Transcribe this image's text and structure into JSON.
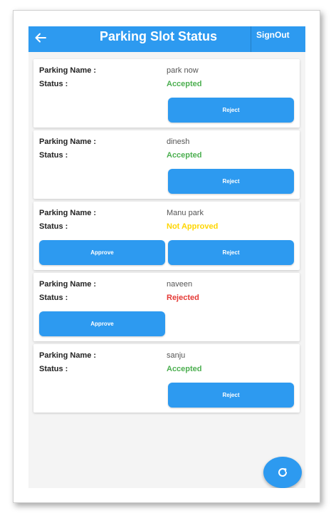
{
  "app_bar": {
    "title": "Parking Slot Status",
    "signout_label": "SignOut",
    "back_icon": "arrow-left-icon",
    "background": "#2d9af0"
  },
  "labels": {
    "parking_name": "Parking Name :",
    "status": "Status :"
  },
  "buttons": {
    "approve": "Approve",
    "reject": "Reject"
  },
  "status_colors": {
    "Accepted": "#4caf50",
    "Not Approved": "#ffd600",
    "Rejected": "#e53935"
  },
  "parkings": [
    {
      "name": "park now",
      "status": "Accepted",
      "actions": [
        "reject"
      ]
    },
    {
      "name": "dinesh",
      "status": "Accepted",
      "actions": [
        "reject"
      ]
    },
    {
      "name": "Manu park",
      "status": "Not Approved",
      "actions": [
        "approve",
        "reject"
      ]
    },
    {
      "name": "naveen",
      "status": "Rejected",
      "actions": [
        "approve"
      ]
    },
    {
      "name": "sanju",
      "status": "Accepted",
      "actions": [
        "reject"
      ]
    }
  ],
  "fab": {
    "icon": "refresh-icon"
  }
}
